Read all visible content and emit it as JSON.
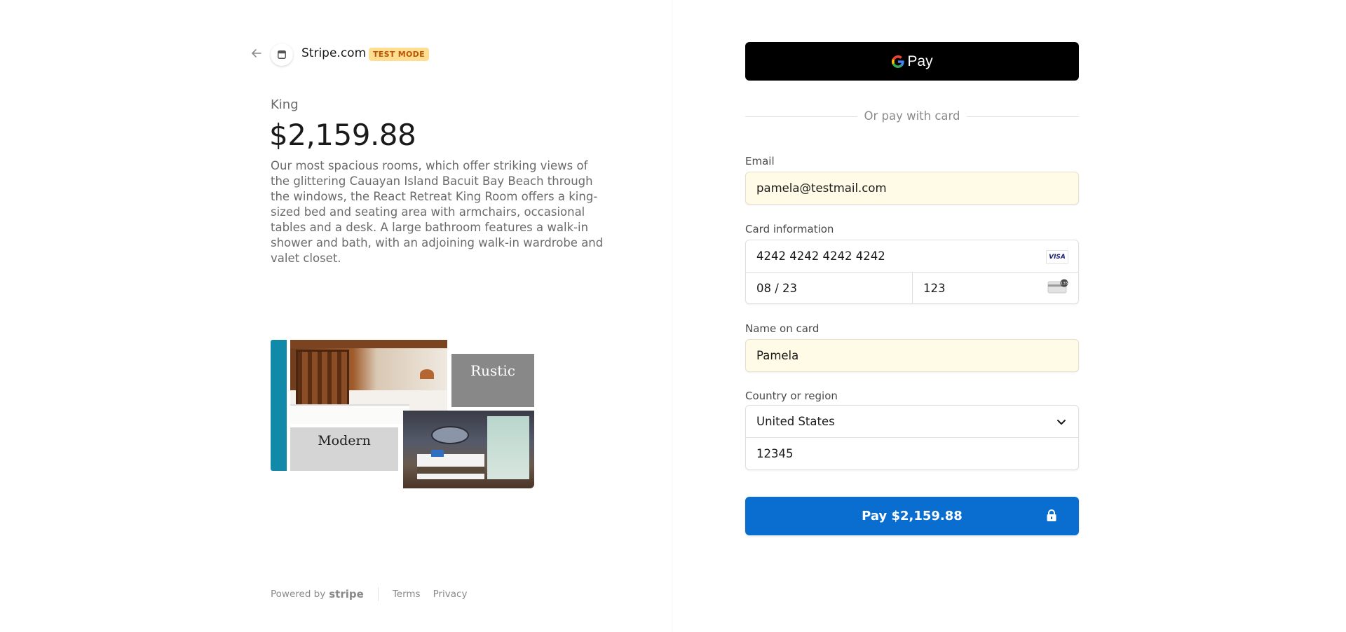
{
  "header": {
    "merchant_name": "Stripe.com",
    "test_badge": "TEST MODE"
  },
  "product": {
    "name": "King",
    "price": "$2,159.88",
    "description": "Our most spacious rooms, which offer striking views of the glittering Cauayan Island Bacuit Bay Beach through the windows, the React Retreat King Room offers a king-sized bed and seating area with armchairs, occasional tables and a desk. A large bathroom features a walk-in shower and bath, with an adjoining walk-in wardrobe and valet closet."
  },
  "collage": {
    "rustic_label": "Rustic",
    "modern_label": "Modern",
    "accent_color": "#118aa9"
  },
  "footer": {
    "powered_by": "Powered by",
    "brand": "stripe",
    "terms": "Terms",
    "privacy": "Privacy"
  },
  "payment": {
    "gpay_label": "Pay",
    "or_divider": "Or pay with card",
    "email_label": "Email",
    "email_value": "pamela@testmail.com",
    "card_label": "Card information",
    "card_number": "4242 4242 4242 4242",
    "card_brand": "VISA",
    "expiry": "08 / 23",
    "cvc": "123",
    "cvc_badge": "135",
    "name_label": "Name on card",
    "name_value": "Pamela",
    "country_label": "Country or region",
    "country_value": "United States",
    "zip_value": "12345",
    "pay_button": "Pay $2,159.88",
    "pay_button_color": "#0a6ed1",
    "autofill_color": "#fffbe6"
  }
}
